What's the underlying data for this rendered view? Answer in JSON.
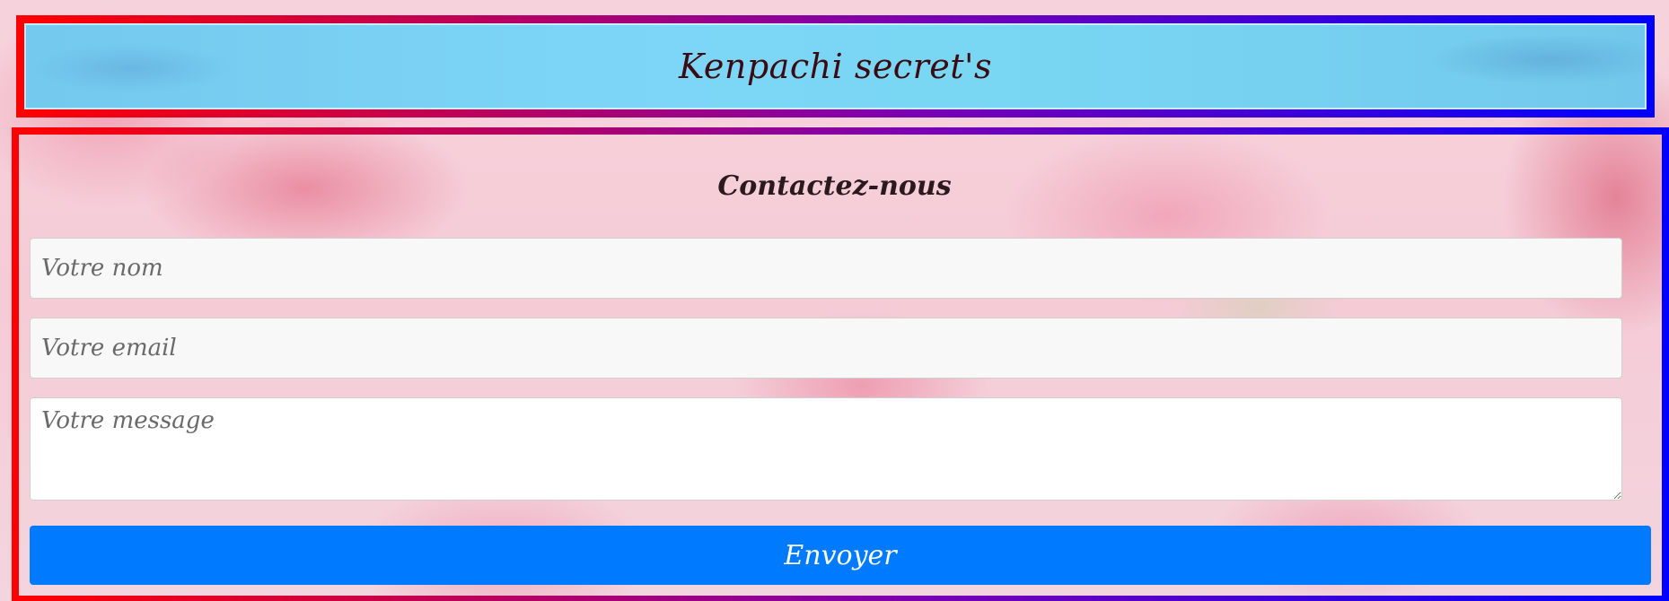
{
  "header": {
    "title": "Kenpachi secret's"
  },
  "contact_form": {
    "title": "Contactez-nous",
    "name_placeholder": "Votre nom",
    "email_placeholder": "Votre email",
    "message_placeholder": "Votre message",
    "submit_label": "Envoyer"
  },
  "colors": {
    "frame_gradient_start": "#ff0000",
    "frame_gradient_end": "#0000ff",
    "header_bg": "#7dd6f7",
    "button_bg": "#007bff"
  }
}
